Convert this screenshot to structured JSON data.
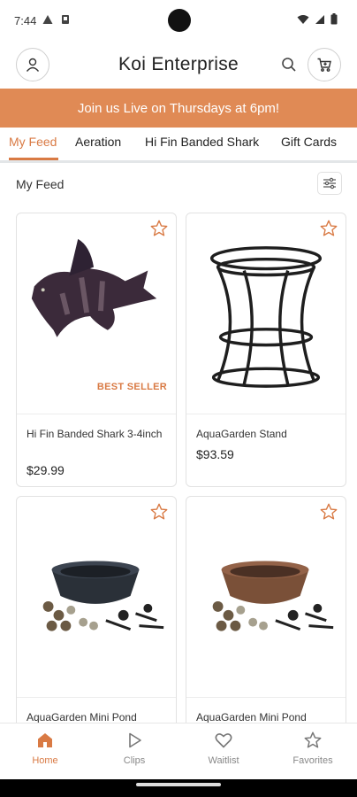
{
  "status_bar": {
    "time": "7:44"
  },
  "header": {
    "title": "Koi Enterprise"
  },
  "banner": {
    "text": "Join us Live on Thursdays at 6pm!"
  },
  "tabs": [
    {
      "label": "My Feed",
      "active": true
    },
    {
      "label": "Aeration"
    },
    {
      "label": "Hi Fin Banded Shark"
    },
    {
      "label": "Gift Cards"
    }
  ],
  "feed": {
    "title": "My Feed"
  },
  "products": [
    {
      "name": "Hi Fin Banded Shark 3-4inch",
      "price": "$29.99",
      "badge": "BEST SELLER"
    },
    {
      "name": "AquaGarden Stand",
      "price": "$93.59"
    },
    {
      "name": "AquaGarden Mini Pond"
    },
    {
      "name": "AquaGarden Mini Pond"
    }
  ],
  "bottom_nav": [
    {
      "label": "Home",
      "icon": "home-icon",
      "active": true
    },
    {
      "label": "Clips",
      "icon": "play-icon"
    },
    {
      "label": "Waitlist",
      "icon": "heart-icon"
    },
    {
      "label": "Favorites",
      "icon": "star-icon"
    }
  ],
  "colors": {
    "accent": "#e08a55",
    "accent_text": "#d97a44"
  }
}
